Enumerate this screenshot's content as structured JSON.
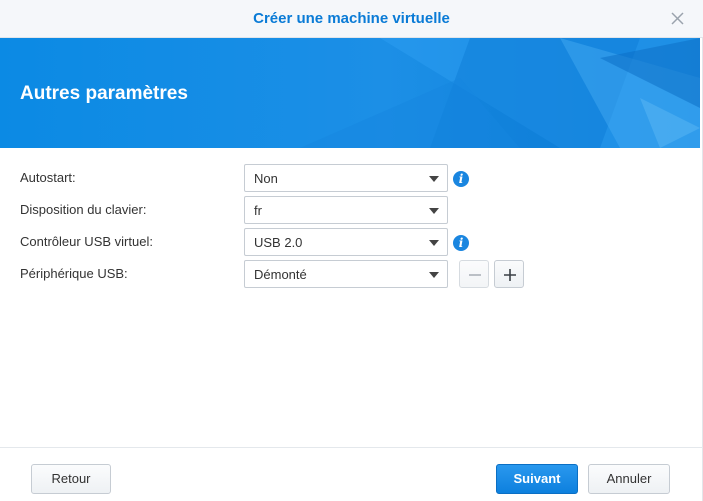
{
  "dialog": {
    "title": "Créer une machine virtuelle",
    "banner_title": "Autres paramètres"
  },
  "form": {
    "rows": [
      {
        "label": "Autostart:",
        "value": "Non",
        "has_info": true
      },
      {
        "label": "Disposition du clavier:",
        "value": "fr",
        "has_info": false
      },
      {
        "label": "Contrôleur USB virtuel:",
        "value": "USB 2.0",
        "has_info": true
      },
      {
        "label": "Périphérique USB:",
        "value": "Démonté",
        "has_info": false
      }
    ],
    "info_glyph": "i"
  },
  "footer": {
    "back_label": "Retour",
    "next_label": "Suivant",
    "cancel_label": "Annuler"
  },
  "icons": {
    "close": "close-icon",
    "info": "info-icon",
    "minus": "minus-icon",
    "plus": "plus-icon",
    "dropdown": "chevron-down-icon"
  },
  "colors": {
    "accent": "#0a7bd6",
    "banner": "#1c8fe6",
    "primary_button": "#1588e4"
  }
}
